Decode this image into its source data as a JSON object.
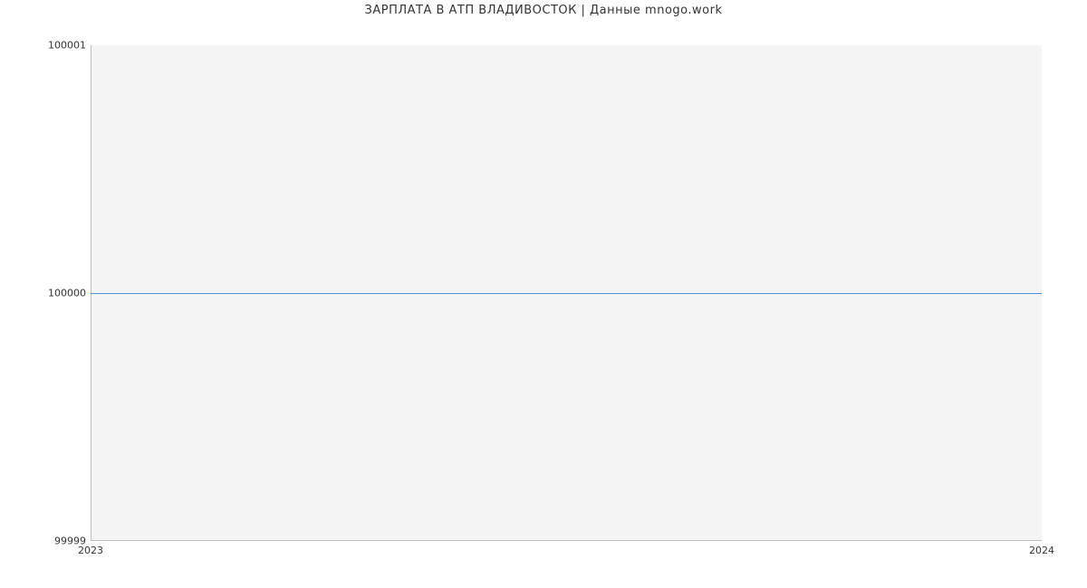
{
  "chart_data": {
    "type": "line",
    "title": "ЗАРПЛАТА В АТП ВЛАДИВОСТОК | Данные mnogo.work",
    "xlabel": "",
    "ylabel": "",
    "x": [
      2023,
      2024
    ],
    "values": [
      100000,
      100000
    ],
    "ylim": [
      99999,
      100001
    ],
    "xlim": [
      2023,
      2024
    ],
    "y_ticks": [
      99999,
      100000,
      100001
    ],
    "x_ticks": [
      2023,
      2024
    ],
    "line_color": "#4e8fd9",
    "plot_bg": "#f4f4f4"
  }
}
